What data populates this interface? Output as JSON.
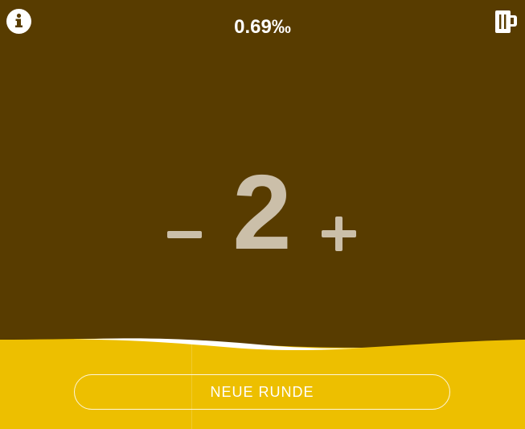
{
  "header": {
    "bac_value": "0.69‰",
    "info_icon": "info-icon",
    "beer_icon": "beer-mug-icon"
  },
  "counter": {
    "count": "2",
    "minus_icon": "minus-icon",
    "plus_icon": "plus-icon"
  },
  "footer": {
    "new_round_label": "NEUE RUNDE"
  },
  "colors": {
    "background": "#583c00",
    "beer": "#edbf00",
    "foam": "#ffffff",
    "counter_text": "#cbbfa9"
  }
}
